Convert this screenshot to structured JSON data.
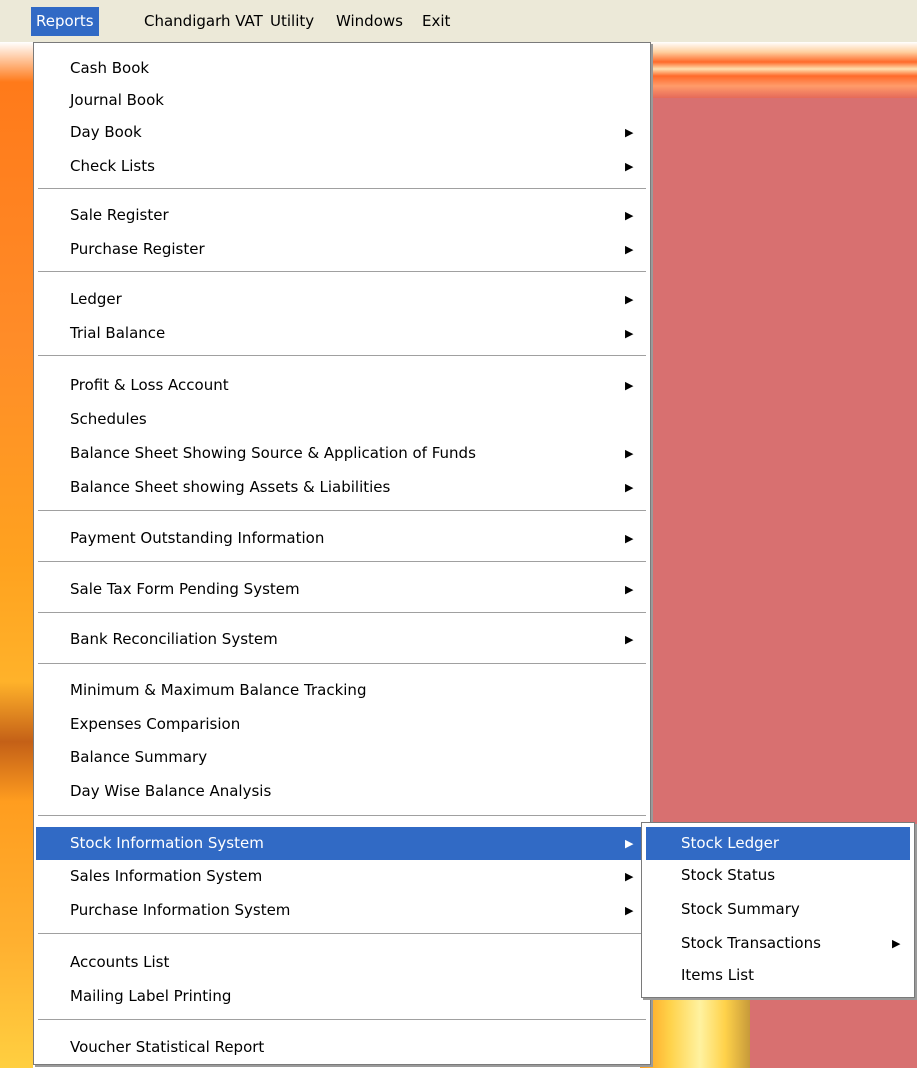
{
  "menubar": {
    "items": [
      "Reports",
      "Chandigarh VAT",
      "Utility",
      "Windows",
      "Exit"
    ],
    "active": "Reports"
  },
  "reports_menu": {
    "items": [
      {
        "label": "Cash Book",
        "submenu": false
      },
      {
        "label": "Journal Book",
        "submenu": false
      },
      {
        "label": "Day Book",
        "submenu": true
      },
      {
        "label": "Check Lists",
        "submenu": true
      },
      {
        "label": "Sale Register",
        "submenu": true
      },
      {
        "label": "Purchase Register",
        "submenu": true
      },
      {
        "label": "Ledger",
        "submenu": true
      },
      {
        "label": "Trial Balance",
        "submenu": true
      },
      {
        "label": "Profit & Loss Account",
        "submenu": true
      },
      {
        "label": "Schedules",
        "submenu": false
      },
      {
        "label": "Balance Sheet Showing Source & Application of Funds",
        "submenu": true
      },
      {
        "label": "Balance Sheet showing Assets & Liabilities",
        "submenu": true
      },
      {
        "label": "Payment Outstanding Information",
        "submenu": true
      },
      {
        "label": "Sale Tax Form Pending System",
        "submenu": true
      },
      {
        "label": "Bank Reconciliation System",
        "submenu": true
      },
      {
        "label": "Minimum & Maximum Balance Tracking",
        "submenu": false
      },
      {
        "label": "Expenses Comparision",
        "submenu": false
      },
      {
        "label": "Balance Summary",
        "submenu": false
      },
      {
        "label": "Day Wise Balance Analysis",
        "submenu": false
      },
      {
        "label": "Stock Information System",
        "submenu": true,
        "highlighted": true
      },
      {
        "label": "Sales Information System",
        "submenu": true
      },
      {
        "label": "Purchase Information System",
        "submenu": true
      },
      {
        "label": "Accounts List",
        "submenu": false
      },
      {
        "label": "Mailing Label Printing",
        "submenu": false
      },
      {
        "label": "Voucher Statistical Report",
        "submenu": false
      }
    ],
    "submenu_arrow": "▶"
  },
  "stock_submenu": {
    "items": [
      {
        "label": "Stock Ledger",
        "submenu": false,
        "highlighted": true
      },
      {
        "label": "Stock Status",
        "submenu": false
      },
      {
        "label": "Stock Summary",
        "submenu": false
      },
      {
        "label": "Stock Transactions",
        "submenu": true
      },
      {
        "label": "Items List",
        "submenu": false
      }
    ]
  },
  "colors": {
    "highlight": "#316ac5",
    "menubar": "#ece9d8",
    "background_panel": "#d87070"
  }
}
